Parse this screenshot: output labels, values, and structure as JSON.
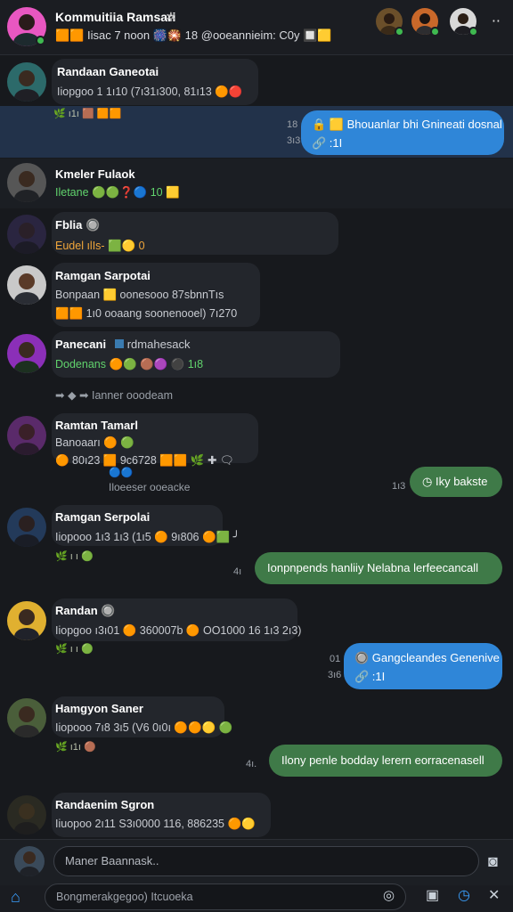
{
  "header": {
    "title": "Kommuitiia Ramsari",
    "subtitle": "🟧🟧 Iisac 7 noon 🎆🎇 18 @ooeannieim: C0y 🔲🟨",
    "gear_icon": "gear-icon",
    "menu_icon": "more-icon"
  },
  "messages": [
    {
      "name": "Randaan Ganeotai",
      "line1": "Iiopgoo 1 1ı10 (7ı31ı300, 81ı13 🟠🔴"
    },
    {
      "reactions": "🌿 ı1ı 🟫 🟧🟧",
      "out_text": "🔒 🟨 Bhouanlar bhi Gnineati dosnal",
      "out_sub": "🔗 :1I",
      "times": [
        "18",
        "3ı3"
      ]
    },
    {
      "name": "Kmeler Fulaok",
      "line1": "Iletane 🟢🟢❓🔵 10 🟨"
    },
    {
      "name": "Fblia 🔘",
      "line1": "Eudel ılIs- 🟩🟡 0"
    },
    {
      "name": "Ramgan Sarpotai",
      "line1": "Bonpaan 🟨 oonesooo 87sbnnTıs",
      "line2": "🟧🟧 1ı0 ooaang soonenooel) 7ı270"
    },
    {
      "name": "Panecani",
      "badge": "rdmahesack",
      "line1": "Dodenans 🟠🟢 🟤🟣 ⚫ 1ı8"
    },
    {
      "system": "➡ ◆ ➡ Ianner ooodeam"
    },
    {
      "name": "Ramtan Tamarl",
      "line1": "Banoaarı 🟠 🟢",
      "line2": "🟠 80ı23 🟧 9c6728 🟧🟧 🌿 ✚ 🗨",
      "reactions": "🔵🔵",
      "under": "Iloeeser ooeacke"
    },
    {
      "out_text": "Iky bakste",
      "time": "1ı3"
    },
    {
      "name": "Ramgan Serpolai",
      "line1": "Iiopooo 1ı3 1ı3 (1ı5 🟠 9ı806 🟠🟩 ╯",
      "reactions": "🌿 ı ı 🟢"
    },
    {
      "out_text": "Ionpnpends hanliiy Nelabna lerfeecancall",
      "time": "4ı"
    },
    {
      "name": "Randan 🔘",
      "line1": "Iiopgoo ı3ı01 🟠 360007b 🟠 OO1000 16 1ı3 2ı3)",
      "reactions": "🌿 ı ı 🟢"
    },
    {
      "out_text": "🔘 Gangcleandes Genenive",
      "out_sub": "🔗 :1I",
      "times": [
        "01",
        "3ı6"
      ]
    },
    {
      "name": "Hamgyon Saner",
      "line1": "Iiopooo 7ı8 3ı5 (V6 0ı0ı 🟠🟠🟡 🟢",
      "reactions": "🌿 ı1ı 🟤"
    },
    {
      "out_text": "Ilony penle bodday lerern eorracenasell",
      "time": "4ı."
    },
    {
      "name": "Randaenim Sgron",
      "line1": "Iiuopoo 2ı11 S3ı0000 116, 886235 🟠🟡"
    }
  ],
  "composer": {
    "placeholder": "Maner Baannask.."
  },
  "bottom_bar": {
    "search_text": "Bongmerakgegoo) Itcuoeka"
  },
  "colors": {
    "bg": "#17191d",
    "bubble_in": "#23262c",
    "out_blue": "#2f86d8",
    "out_green": "#3f7a48",
    "highlight": "#24344f"
  }
}
